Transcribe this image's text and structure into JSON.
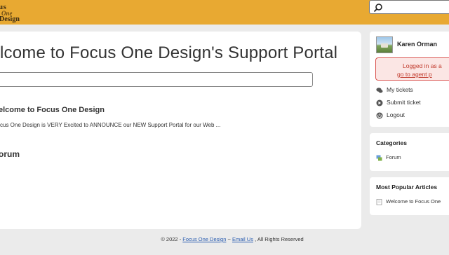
{
  "header": {
    "logo": {
      "line1": "us",
      "line2": "One",
      "line3": "Design"
    },
    "search": {
      "icon": "search-icon"
    },
    "colors": {
      "bar": "#e8a932"
    }
  },
  "main": {
    "title": "lcome to Focus One Design's Support Portal",
    "search_value": "",
    "article": {
      "title": "elcome to Focus One Design",
      "excerpt": "cus One Design is VERY Excited to ANNOUNCE our NEW Support Portal for our Web ..."
    },
    "section": "orum"
  },
  "sidebar": {
    "user": {
      "name": "Karen Orman",
      "alert_line1": "Logged in as a",
      "alert_line2": "go to agent p",
      "nav": [
        {
          "label": "My tickets",
          "icon": "chat-bubbles-icon"
        },
        {
          "label": "Submit ticket",
          "icon": "arrow-right-circle-icon"
        },
        {
          "label": "Logout",
          "icon": "power-icon"
        }
      ]
    },
    "categories": {
      "title": "Categories",
      "items": [
        {
          "label": "Forum",
          "icon": "forum-icon"
        }
      ]
    },
    "popular": {
      "title": "Most Popular Articles",
      "items": [
        {
          "label": "Welcome to Focus One",
          "icon": "document-icon"
        }
      ]
    }
  },
  "footer": {
    "prefix": "© 2022 - ",
    "company_link": "Focus One Design",
    "separator": " ~ ",
    "email_link": "Email Us",
    "suffix": " , All Rights Reserved"
  }
}
